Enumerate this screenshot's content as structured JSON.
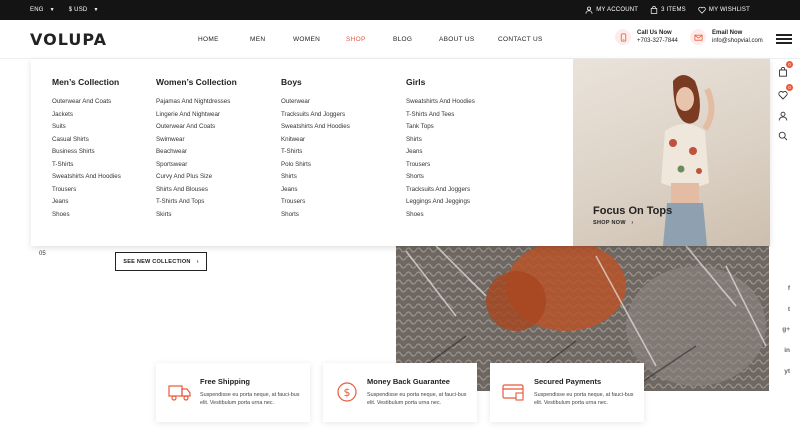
{
  "topbar": {
    "language": "ENG",
    "currency": "$ USD",
    "account": "MY ACCOUNT",
    "cart": "3 ITEMS",
    "wishlist": "MY WISHLIST"
  },
  "header": {
    "logo": "VOLUPA",
    "nav": [
      "HOME",
      "MEN",
      "WOMEN",
      "SHOP",
      "BLOG",
      "ABOUT US",
      "CONTACT US"
    ],
    "active_nav": "SHOP",
    "call_label": "Call Us Now",
    "call_value": "+703-327-7844",
    "email_label": "Email Now",
    "email_value": "info@shopvial.com"
  },
  "mega": {
    "columns": [
      {
        "title": "Men’s Collection",
        "items": [
          "Outerwear And Coats",
          "Jackets",
          "Suits",
          "Casual Shirts",
          "Business Shirts",
          "T-Shirts",
          "Sweatshirts And Hoodies",
          "Trousers",
          "Jeans",
          "Shoes"
        ]
      },
      {
        "title": "Women’s Collection",
        "items": [
          "Pajamas And Nightdresses",
          "Lingerie And Nightwear",
          "Outerwear And Coats",
          "Swimwear",
          "Beachwear",
          "Sportswear",
          "Curvy And Plus Size",
          "Shirts And Blouses",
          "T-Shirts And Tops",
          "Skirts"
        ]
      },
      {
        "title": "Boys",
        "items": [
          "Outerwear",
          "Tracksuits And Joggers",
          "Sweatshirts And Hoodies",
          "Knitwear",
          "T-Shirts",
          "Polo Shirts",
          "Shirts",
          "Jeans",
          "Trousers",
          "Shorts"
        ]
      },
      {
        "title": "Girls",
        "items": [
          "Sweatshirts And Hoodies",
          "T-Shirts And Tees",
          "Tank Tops",
          "Shirts",
          "Jeans",
          "Trousers",
          "Shorts",
          "Tracksuits And Joggers",
          "Leggings And Jeggings",
          "Shoes"
        ]
      }
    ],
    "promo_title": "Focus On Tops",
    "promo_link": "SHOP NOW"
  },
  "rail": {
    "cart_badge": "0",
    "wishlist_badge": "0",
    "social": [
      "f",
      "t",
      "g+",
      "in",
      "yt"
    ]
  },
  "hero": {
    "slide_number": "05",
    "button": "SEE NEW COLLECTION"
  },
  "features": [
    {
      "title": "Free Shipping",
      "text": "Suspendisse eu porta neque, at fauci-bus elit. Vestibulum porta urna nec."
    },
    {
      "title": "Money Back Guarantee",
      "text": "Suspendisse eu porta neque, at fauci-bus elit. Vestibulum porta urna nec."
    },
    {
      "title": "Secured Payments",
      "text": "Suspendisse eu porta neque, at fauci-bus elit. Vestibulum porta urna nec."
    }
  ],
  "colors": {
    "accent": "#e8593a",
    "topbar": "#141414",
    "text": "#222222"
  }
}
